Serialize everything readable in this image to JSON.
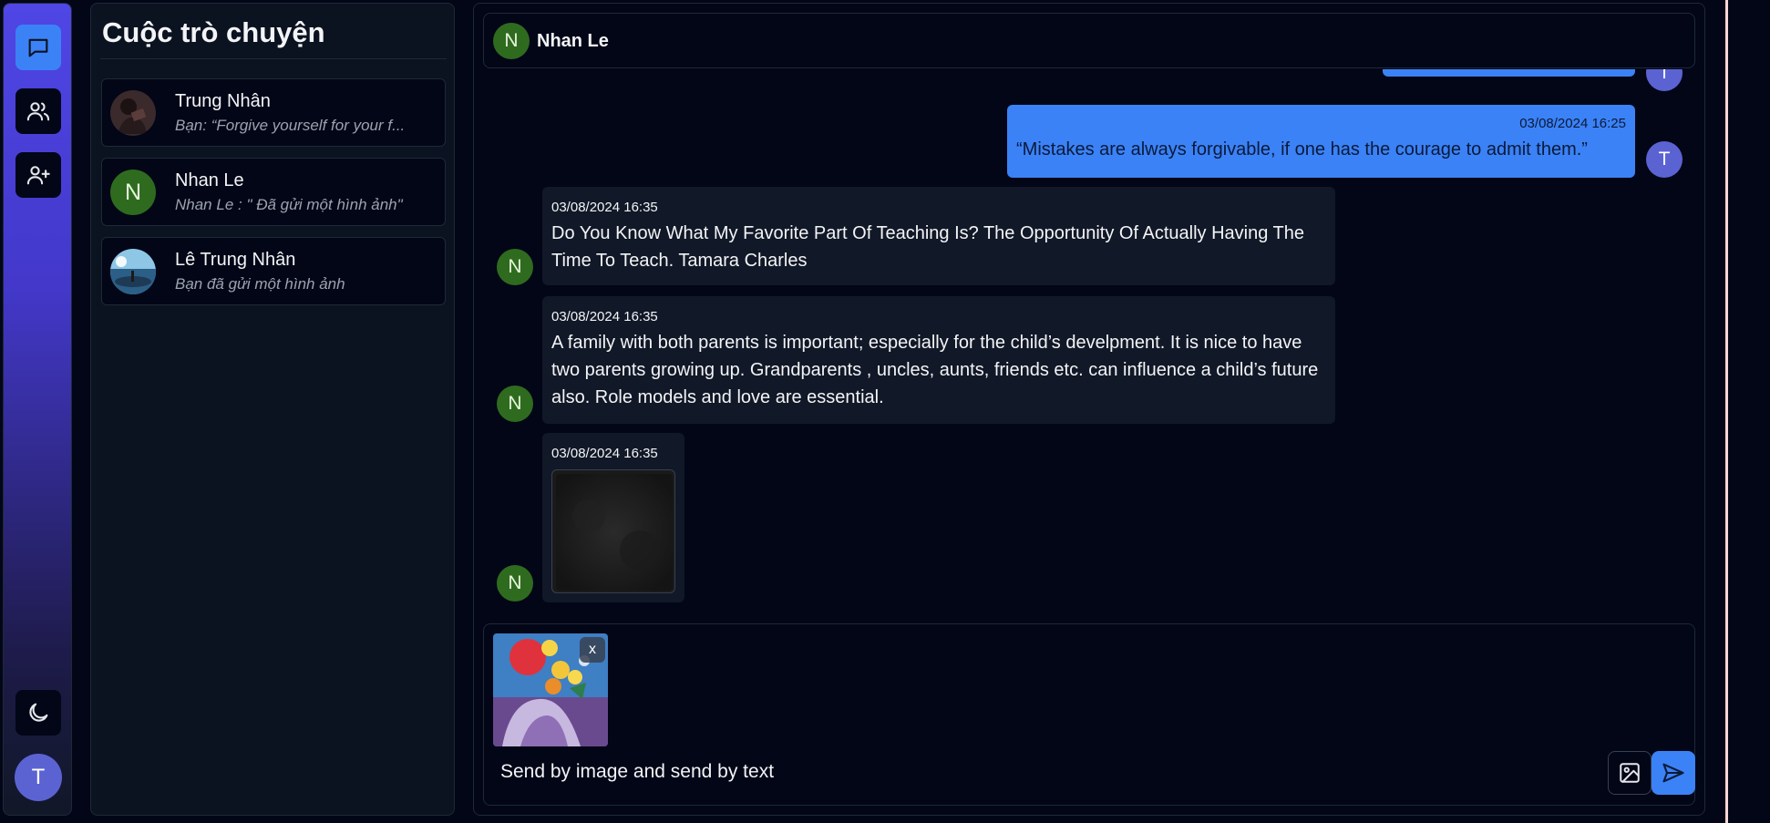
{
  "theme": {
    "accent": "#3b82f6",
    "rail_gradient_top": "#4f46e5",
    "avatar_n": "#2f6b1f",
    "avatar_t": "#5b63d3"
  },
  "rail": {
    "items": [
      {
        "icon": "chat-bubble-icon",
        "active": true
      },
      {
        "icon": "users-icon",
        "active": false
      },
      {
        "icon": "user-plus-icon",
        "active": false
      }
    ],
    "theme_toggle_icon": "moon-icon",
    "user_initial": "T"
  },
  "conversations": {
    "title": "Cuộc trò chuyện",
    "items": [
      {
        "name": "Trung Nhân",
        "preview": "Bạn: “Forgive yourself for your f...",
        "avatar": "photo"
      },
      {
        "name": "Nhan Le",
        "preview": "Nhan Le : \" Đã gửi một hình ảnh\"",
        "avatar": "N"
      },
      {
        "name": "Lê Trung Nhân",
        "preview": "Bạn đã gửi một hình ảnh",
        "avatar": "photo"
      }
    ]
  },
  "chat": {
    "header": {
      "initial": "N",
      "name": "Nhan Le"
    },
    "messages": [
      {
        "direction": "out",
        "avatar": "T",
        "time": "03/08/2024 16:25",
        "text": "“Mistakes are always forgivable, if one has the courage to admit them.”"
      },
      {
        "direction": "in",
        "avatar": "N",
        "time": "03/08/2024 16:35",
        "text": "Do You Know What My Favorite Part Of Teaching Is? The Opportunity Of Actually Having The Time To Teach. Tamara Charles"
      },
      {
        "direction": "in",
        "avatar": "N",
        "time": "03/08/2024 16:35",
        "text": "A family with both parents is important; especially for the child’s develpment. It is nice to have two parents growing up. Grandparents , uncles, aunts, friends etc. can influence a child’s future also. Role models and love are essential."
      },
      {
        "direction": "in",
        "avatar": "N",
        "time": "03/08/2024 16:35",
        "text": "",
        "image": "dark-photo"
      }
    ],
    "composer": {
      "attachment_remove_label": "x",
      "input_value": "Send by image and send by text",
      "image_button_icon": "image-icon",
      "send_button_icon": "send-icon"
    }
  }
}
